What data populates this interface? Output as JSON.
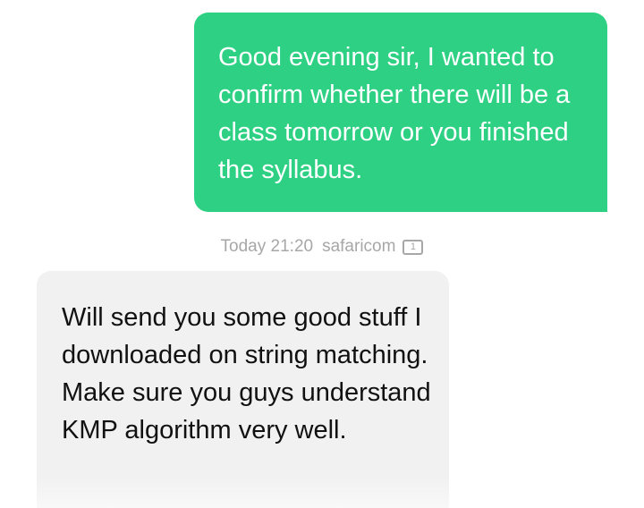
{
  "messages": [
    {
      "direction": "sent",
      "text": "Good evening sir, I wanted to confirm whether there will be a class tomorrow or you finished the syllabus.",
      "bubble_color": "#2ed183"
    },
    {
      "direction": "received",
      "text": "Will send you some good stuff I downloaded on string matching. Make sure you guys understand KMP algorithm very well.",
      "bubble_color": "#f1f1f1"
    }
  ],
  "meta": {
    "time": "Today 21:20",
    "carrier": "safaricom",
    "sim_slot": "1",
    "sim_icon": "sim-card-icon"
  }
}
